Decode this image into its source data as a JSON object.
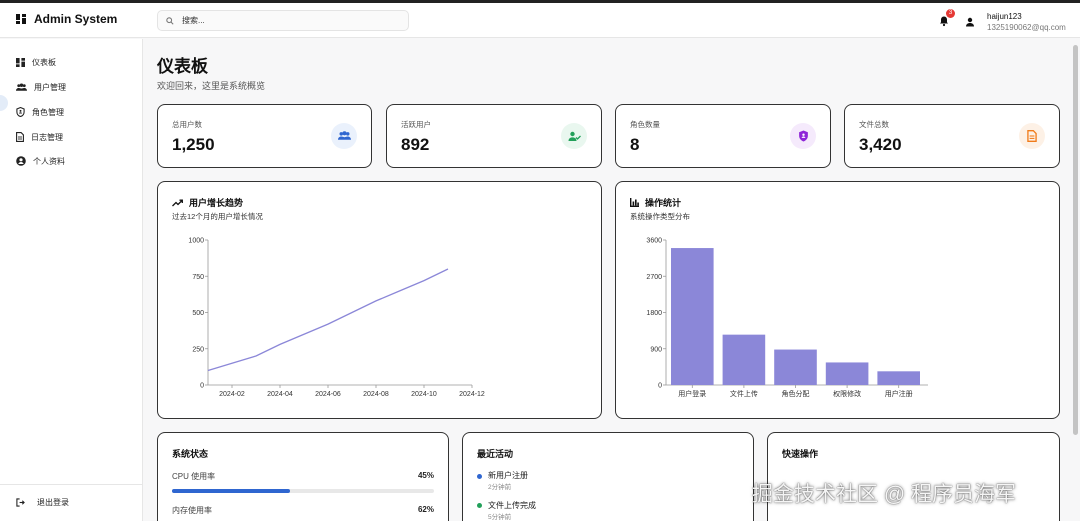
{
  "app": {
    "title": "Admin System"
  },
  "search": {
    "placeholder": "搜索..."
  },
  "header": {
    "notification_count": "3",
    "username": "haijun123",
    "email": "1325190062@qq.com"
  },
  "sidebar": {
    "items": [
      {
        "label": "仪表板",
        "icon": "dashboard-icon"
      },
      {
        "label": "用户管理",
        "icon": "users-icon"
      },
      {
        "label": "角色管理",
        "icon": "shield-icon"
      },
      {
        "label": "日志管理",
        "icon": "log-icon"
      },
      {
        "label": "个人资料",
        "icon": "profile-icon"
      }
    ],
    "logout_label": "退出登录"
  },
  "page": {
    "title": "仪表板",
    "subtitle": "欢迎回来，这里是系统概览"
  },
  "stats": [
    {
      "label": "总用户数",
      "value": "1,250",
      "icon": "users-icon",
      "color": "#2f66d0"
    },
    {
      "label": "活跃用户",
      "value": "892",
      "icon": "user-check-icon",
      "color": "#22a05a"
    },
    {
      "label": "角色数量",
      "value": "8",
      "icon": "shield-icon",
      "color": "#8e24d8"
    },
    {
      "label": "文件总数",
      "value": "3,420",
      "icon": "file-icon",
      "color": "#f07b1a"
    }
  ],
  "growth": {
    "title": "用户增长趋势",
    "subtitle": "过去12个月的用户增长情况"
  },
  "ops": {
    "title": "操作统计",
    "subtitle": "系统操作类型分布"
  },
  "chart_data": [
    {
      "type": "line",
      "x": [
        "2024-01",
        "2024-02",
        "2024-03",
        "2024-04",
        "2024-05",
        "2024-06",
        "2024-07",
        "2024-08",
        "2024-09",
        "2024-10",
        "2024-11"
      ],
      "values": [
        100,
        150,
        200,
        280,
        350,
        420,
        500,
        580,
        650,
        720,
        800
      ],
      "xticks": [
        "2024-02",
        "2024-04",
        "2024-06",
        "2024-08",
        "2024-10",
        "2024-12"
      ],
      "yticks": [
        "0",
        "250",
        "500",
        "750",
        "1000"
      ],
      "ylim": [
        0,
        1000
      ],
      "color": "#8b87d8",
      "grid": false
    },
    {
      "type": "bar",
      "categories": [
        "用户登录",
        "文件上传",
        "角色分配",
        "权限修改",
        "用户注册"
      ],
      "values": [
        3400,
        1250,
        880,
        560,
        340
      ],
      "yticks": [
        "0",
        "900",
        "1800",
        "2700",
        "3600"
      ],
      "ylim": [
        0,
        3600
      ],
      "color": "#8b87d8",
      "grid": false
    }
  ],
  "system": {
    "title": "系统状态",
    "items": [
      {
        "label": "CPU 使用率",
        "value": "45%",
        "percent": 45
      },
      {
        "label": "内存使用率",
        "value": "62%",
        "percent": 62
      }
    ]
  },
  "activity": {
    "title": "最近活动",
    "items": [
      {
        "title": "新用户注册",
        "time": "2分钟前",
        "color": "#2f66d0"
      },
      {
        "title": "文件上传完成",
        "time": "5分钟前",
        "color": "#22a05a"
      }
    ]
  },
  "quick": {
    "title": "快速操作"
  },
  "watermark": "掘金技术社区 @ 程序员海军"
}
